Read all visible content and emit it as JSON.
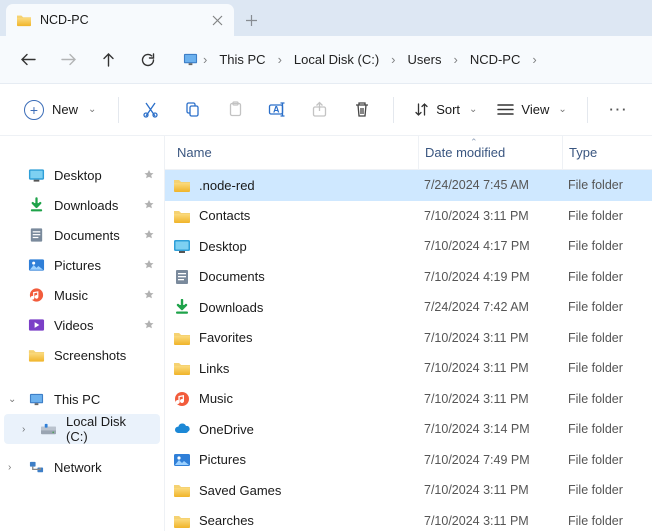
{
  "tab": {
    "title": "NCD-PC"
  },
  "breadcrumb": [
    "This PC",
    "Local Disk (C:)",
    "Users",
    "NCD-PC"
  ],
  "toolbar": {
    "new_label": "New",
    "sort_label": "Sort",
    "view_label": "View"
  },
  "sidebar": {
    "quick": [
      {
        "label": "Desktop",
        "icon": "desktop",
        "pinned": true
      },
      {
        "label": "Downloads",
        "icon": "download",
        "pinned": true
      },
      {
        "label": "Documents",
        "icon": "document",
        "pinned": true
      },
      {
        "label": "Pictures",
        "icon": "pictures",
        "pinned": true
      },
      {
        "label": "Music",
        "icon": "music",
        "pinned": true
      },
      {
        "label": "Videos",
        "icon": "videos",
        "pinned": true
      },
      {
        "label": "Screenshots",
        "icon": "folder",
        "pinned": false
      }
    ],
    "thispc_label": "This PC",
    "localdisk_label": "Local Disk (C:)",
    "network_label": "Network"
  },
  "columns": {
    "name": "Name",
    "date": "Date modified",
    "type": "Type"
  },
  "files": [
    {
      "name": ".node-red",
      "icon": "folder",
      "date": "7/24/2024 7:45 AM",
      "type": "File folder",
      "selected": true
    },
    {
      "name": "Contacts",
      "icon": "folder",
      "date": "7/10/2024 3:11 PM",
      "type": "File folder"
    },
    {
      "name": "Desktop",
      "icon": "desktop",
      "date": "7/10/2024 4:17 PM",
      "type": "File folder"
    },
    {
      "name": "Documents",
      "icon": "document",
      "date": "7/10/2024 4:19 PM",
      "type": "File folder"
    },
    {
      "name": "Downloads",
      "icon": "download",
      "date": "7/24/2024 7:42 AM",
      "type": "File folder"
    },
    {
      "name": "Favorites",
      "icon": "folder",
      "date": "7/10/2024 3:11 PM",
      "type": "File folder"
    },
    {
      "name": "Links",
      "icon": "folder",
      "date": "7/10/2024 3:11 PM",
      "type": "File folder"
    },
    {
      "name": "Music",
      "icon": "music",
      "date": "7/10/2024 3:11 PM",
      "type": "File folder"
    },
    {
      "name": "OneDrive",
      "icon": "onedrive",
      "date": "7/10/2024 3:14 PM",
      "type": "File folder"
    },
    {
      "name": "Pictures",
      "icon": "pictures",
      "date": "7/10/2024 7:49 PM",
      "type": "File folder"
    },
    {
      "name": "Saved Games",
      "icon": "folder",
      "date": "7/10/2024 3:11 PM",
      "type": "File folder"
    },
    {
      "name": "Searches",
      "icon": "folder",
      "date": "7/10/2024 3:11 PM",
      "type": "File folder"
    }
  ]
}
